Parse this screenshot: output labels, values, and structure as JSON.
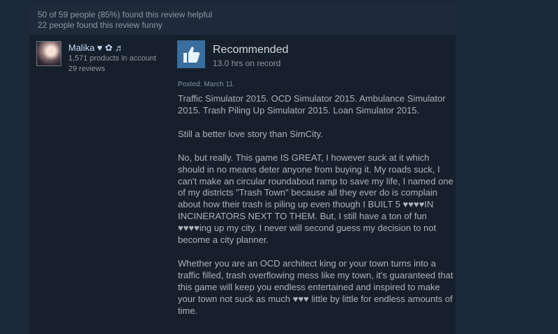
{
  "review": {
    "helpful_text": "50 of 59 people (85%) found this review helpful",
    "funny_text": "22 people found this review funny",
    "author": {
      "name": "Malika ♥ ✿ ♬",
      "products": "1,571 products in account",
      "reviews": "29 reviews"
    },
    "verdict": "Recommended",
    "hours": "13.0 hrs on record",
    "posted": "Posted: March 11",
    "paragraphs": [
      "Traffic Simulator 2015. OCD Simulator 2015. Ambulance Simulator 2015. Trash Piling Up Simulator 2015. Loan Simulator 2015.",
      "Still a better love story than SimCity.",
      "No, but really. This game IS GREAT, I however suck at it which should in no means deter anyone from buying it. My roads suck, I can't make an circular roundabout ramp to save my life, I named one of my districts \"Trash Town\" because all they ever do is complain about how their trash is piling up even though I BUILT 5 ♥♥♥♥IN INCINERATORS NEXT TO THEM. But, I still have a ton of fun ♥♥♥♥ing up my city. I never will second guess my decision to not become a city planner.",
      "Whether you are an OCD architect king or your town turns into a traffic filled, trash overflowing mess like my town, it's guaranteed that this game will keep you endless entertained and inspired to make your town not suck as much ♥♥♥ little by little for endless amounts of time."
    ]
  },
  "colors": {
    "background": "#1b2838",
    "card": "#16202d",
    "thumb_box": "#3a6e9e",
    "author_name": "#c1dbf4",
    "body_text": "#acb2b8"
  },
  "icons": {
    "verdict": "thumbs-up-icon"
  }
}
